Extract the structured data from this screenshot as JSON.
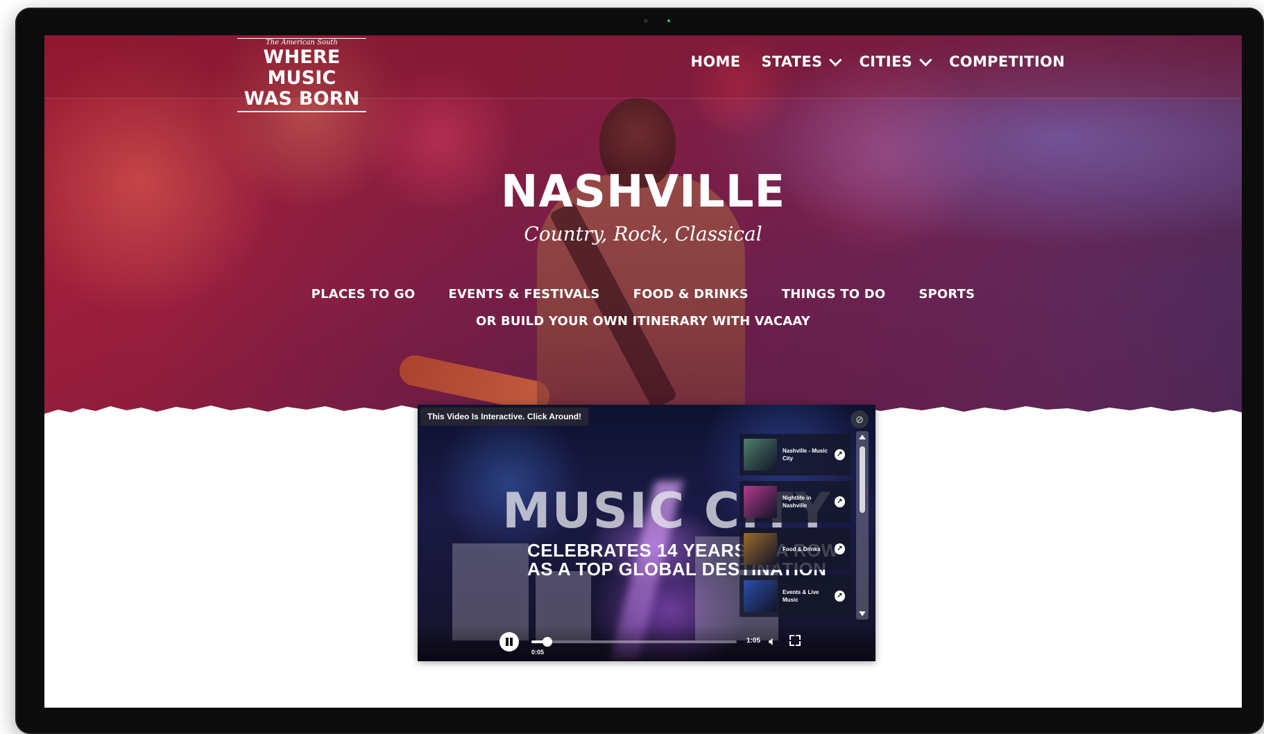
{
  "brand": {
    "tagline": "The American South",
    "line1": "WHERE MUSIC",
    "line2": "WAS BORN"
  },
  "nav": {
    "items": [
      {
        "label": "HOME",
        "dropdown": false
      },
      {
        "label": "STATES",
        "dropdown": true
      },
      {
        "label": "CITIES",
        "dropdown": true
      },
      {
        "label": "COMPETITION",
        "dropdown": false
      }
    ]
  },
  "hero": {
    "title": "NASHVILLE",
    "subtitle": "Country, Rock, Classical",
    "links": [
      "PLACES TO GO",
      "EVENTS & FESTIVALS",
      "FOOD & DRINKS",
      "THINGS TO DO",
      "SPORTS"
    ],
    "itinerary": "OR BUILD YOUR OWN ITINERARY WITH VACAAY",
    "colors": {
      "primary": "#a51f3a",
      "secondary": "#4a2b5c"
    }
  },
  "video": {
    "notice": "This Video Is Interactive. Click Around!",
    "overlay_title": "MUSIC CITY",
    "overlay_line1": "CELEBRATES 14 YEARS IN A ROW",
    "overlay_line2": "AS A TOP GLOBAL DESTINATION",
    "playlist": [
      {
        "label": "Nashville - Music City",
        "thumb_color": "#4f7f6a"
      },
      {
        "label": "Nightlife in Nashville",
        "thumb_color": "#b23a8c"
      },
      {
        "label": "Food & Drinks",
        "thumb_color": "#9a6a2a"
      },
      {
        "label": "Events & Live Music",
        "thumb_color": "#2c4fa8"
      }
    ],
    "current_time": "0:05",
    "duration": "1:05",
    "progress": 0.077
  }
}
